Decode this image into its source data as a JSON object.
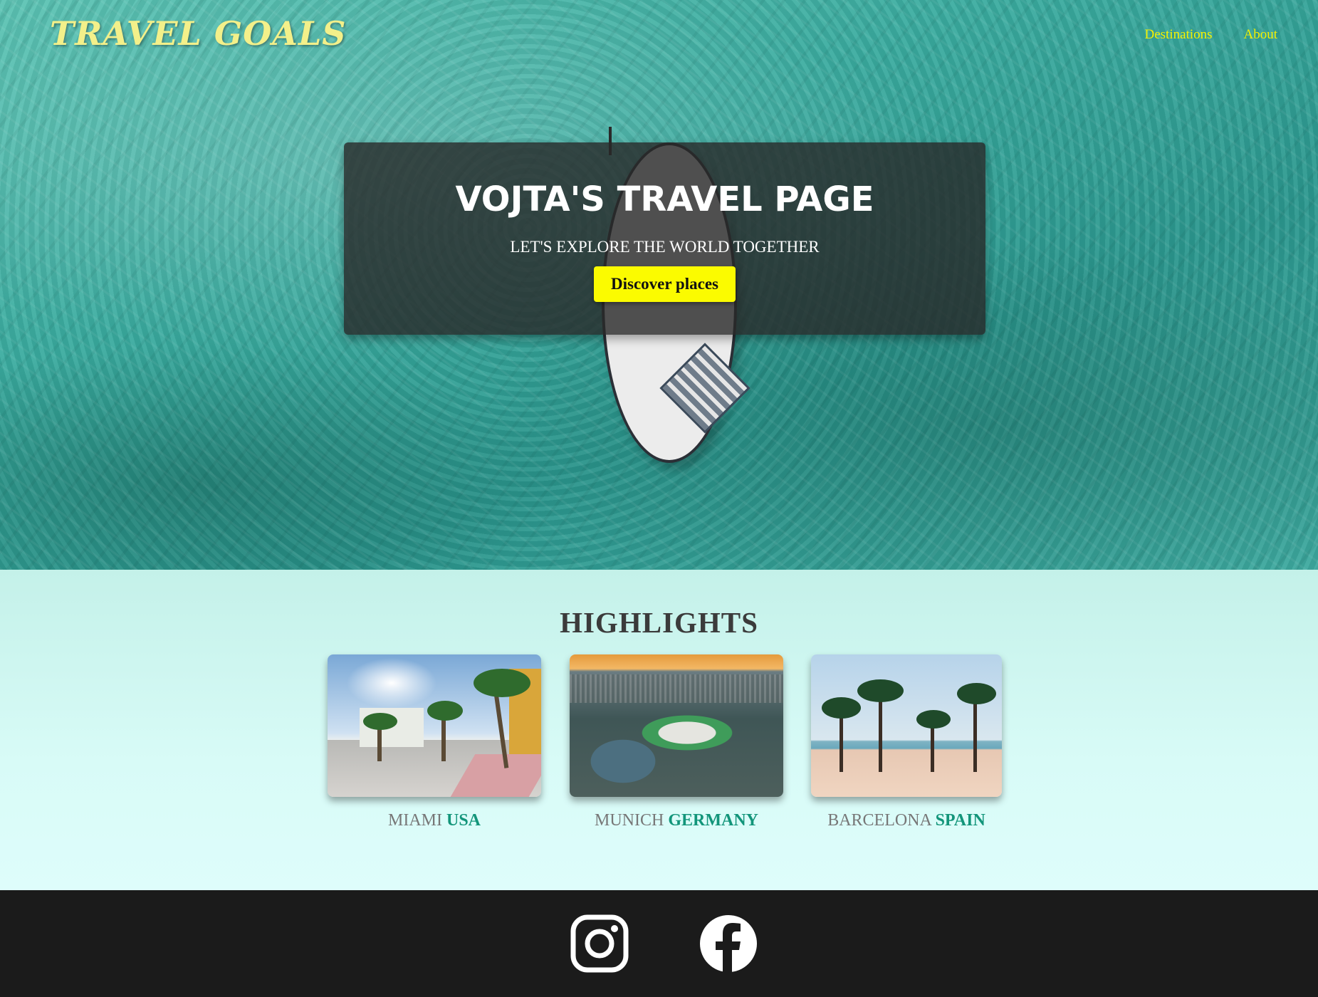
{
  "header": {
    "brand": "TRAVEL GOALS",
    "nav": [
      {
        "label": "Destinations"
      },
      {
        "label": "About"
      }
    ]
  },
  "hero": {
    "title": "VOJTA'S TRAVEL PAGE",
    "tagline": "LET'S EXPLORE THE WORLD TOGETHER",
    "cta_label": "Discover places"
  },
  "highlights": {
    "title": "HIGHLIGHTS",
    "cards": [
      {
        "city": "MIAMI",
        "country": "USA"
      },
      {
        "city": "MUNICH",
        "country": "GERMANY"
      },
      {
        "city": "BARCELONA",
        "country": "SPAIN"
      }
    ]
  },
  "footer": {
    "icons": [
      "instagram-icon",
      "facebook-icon"
    ]
  },
  "colors": {
    "brand": "#f3f08a",
    "nav_link": "#f6f200",
    "cta": "#fbfb00",
    "country_accent": "#12957a",
    "footer_bg": "#1b1b1b"
  }
}
